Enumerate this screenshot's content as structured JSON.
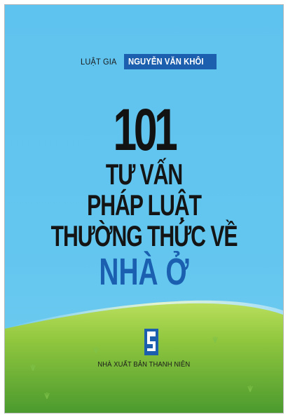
{
  "cover": {
    "author_prefix": "LUẬT GIA",
    "author_name": "NGUYỄN VĂN KHÔI",
    "title_number": "101",
    "title_line1": "TƯ VẤN",
    "title_line2": "PHÁP LUẬT",
    "title_line3": "THƯỜNG THỨC VỀ",
    "title_accent": "NHÀ Ở",
    "publisher": "NHÀ XUẤT BẢN THANH NIÊN",
    "publisher_logo_icon": "publisher-logo-icon"
  },
  "colors": {
    "sky": "#63c6ef",
    "grass_light": "#a6d64a",
    "grass_dark": "#4c9a2c",
    "author_box": "#1b5fae",
    "accent_title": "#1a5fb0",
    "title_text": "#141414",
    "logo": "#1b5fae"
  }
}
